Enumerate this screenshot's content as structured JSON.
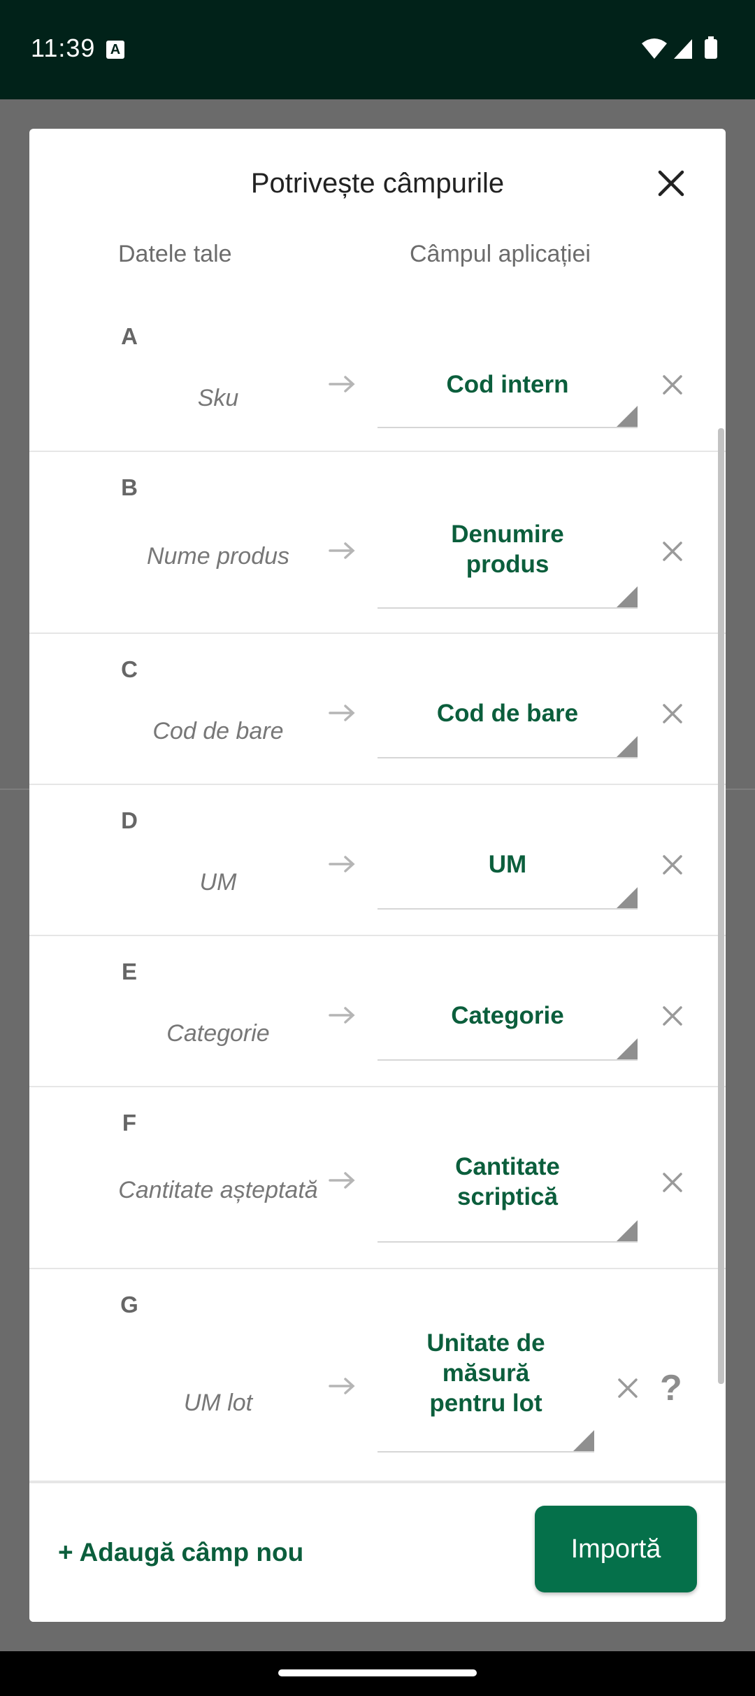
{
  "status_bar": {
    "time": "11:39",
    "notification_icon": "A"
  },
  "dialog": {
    "title": "Potrivește câmpurile",
    "column_headers": {
      "your_data": "Datele tale",
      "app_field": "Câmpul aplicației"
    },
    "rows": [
      {
        "letter": "A",
        "source": "Sku",
        "field": "Cod intern"
      },
      {
        "letter": "B",
        "source": "Nume produs",
        "field": "Denumire\nprodus"
      },
      {
        "letter": "C",
        "source": "Cod de bare",
        "field": "Cod de bare"
      },
      {
        "letter": "D",
        "source": "UM",
        "field": "UM"
      },
      {
        "letter": "E",
        "source": "Categorie",
        "field": "Categorie"
      },
      {
        "letter": "F",
        "source": "Cantitate așteptată",
        "field": "Cantitate\nscriptică"
      },
      {
        "letter": "G",
        "source": "UM lot",
        "field": "Unitate de\nmăsură\npentru lot",
        "help": "?"
      }
    ],
    "footer": {
      "add_field_label": "+ Adaugă câmp nou",
      "import_label": "Importă"
    }
  },
  "colors": {
    "accent": "#0b5e3c",
    "button": "#05704a",
    "status_bar": "#012219"
  }
}
